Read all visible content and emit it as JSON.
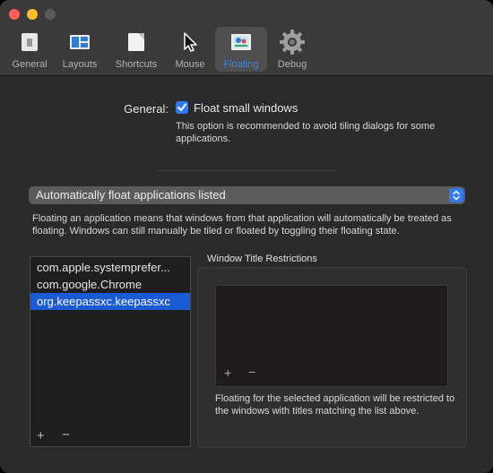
{
  "toolbar": {
    "tabs": [
      {
        "label": "General",
        "icon": "general-icon"
      },
      {
        "label": "Layouts",
        "icon": "layouts-icon"
      },
      {
        "label": "Shortcuts",
        "icon": "shortcuts-icon"
      },
      {
        "label": "Mouse",
        "icon": "mouse-pointer-icon"
      },
      {
        "label": "Floating",
        "icon": "floating-icon"
      },
      {
        "label": "Debug",
        "icon": "gear-icon"
      }
    ],
    "active_tab": "Floating"
  },
  "general": {
    "label": "General:",
    "float_small_windows": {
      "label": "Float small windows",
      "checked": true,
      "help": "This option is recommended to avoid tiling dialogs for some applications."
    }
  },
  "float_mode": {
    "selected": "Automatically float applications listed",
    "help": "Floating an application means that windows from that application will automatically be treated as floating. Windows can still manually be tiled or floated by toggling their floating state."
  },
  "applications": {
    "items": [
      "com.apple.systemprefer...",
      "com.google.Chrome",
      "org.keepassxc.keepassxc"
    ],
    "selected_index": 2,
    "add_label": "+",
    "remove_label": "−"
  },
  "window_title_restrictions": {
    "title": "Window Title Restrictions",
    "add_label": "+",
    "remove_label": "−",
    "help": "Floating for the selected application will be restricted to the windows with titles matching the list above."
  },
  "colors": {
    "accent": "#2f7bf5",
    "selection": "#1a5ad4",
    "active_tab_label": "#2f87ff"
  }
}
